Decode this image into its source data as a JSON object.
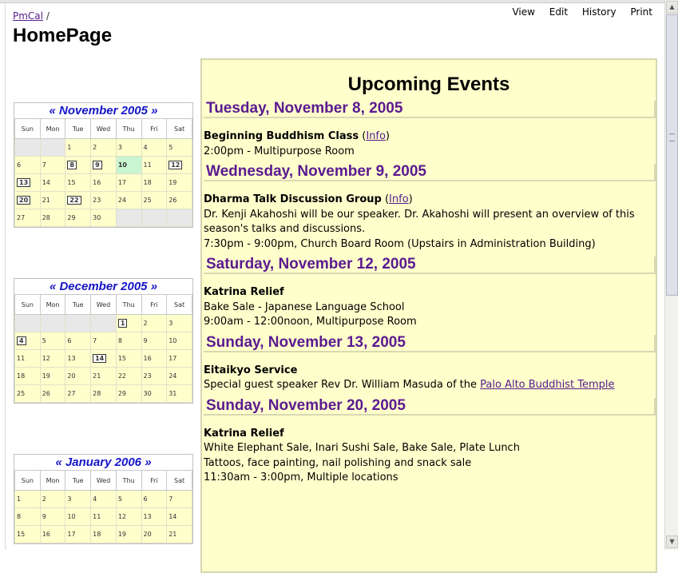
{
  "breadcrumb": {
    "link": "PmCal",
    "sep": "/"
  },
  "page_title": "HomePage",
  "actions": [
    "View",
    "Edit",
    "History",
    "Print"
  ],
  "weekdays": [
    "Sun",
    "Mon",
    "Tue",
    "Wed",
    "Thu",
    "Fri",
    "Sat"
  ],
  "calendars": [
    {
      "prev": "«",
      "month": "November 2005",
      "next": "»",
      "weeks": [
        [
          "",
          "",
          "1",
          "2",
          "3",
          "4",
          "5"
        ],
        [
          "6",
          "7",
          "8",
          "9",
          "10",
          "11",
          "12"
        ],
        [
          "13",
          "14",
          "15",
          "16",
          "17",
          "18",
          "19"
        ],
        [
          "20",
          "21",
          "22",
          "23",
          "24",
          "25",
          "26"
        ],
        [
          "27",
          "28",
          "29",
          "30",
          "",
          "",
          ""
        ]
      ],
      "event_days": [
        "8",
        "9",
        "12",
        "13",
        "20",
        "22"
      ],
      "today": "10"
    },
    {
      "prev": "«",
      "month": "December 2005",
      "next": "»",
      "weeks": [
        [
          "",
          "",
          "",
          "",
          "1",
          "2",
          "3"
        ],
        [
          "4",
          "5",
          "6",
          "7",
          "8",
          "9",
          "10"
        ],
        [
          "11",
          "12",
          "13",
          "14",
          "15",
          "16",
          "17"
        ],
        [
          "18",
          "19",
          "20",
          "21",
          "22",
          "23",
          "24"
        ],
        [
          "25",
          "26",
          "27",
          "28",
          "29",
          "30",
          "31"
        ]
      ],
      "event_days": [
        "1",
        "4",
        "14"
      ],
      "today": ""
    },
    {
      "prev": "«",
      "month": "January 2006",
      "next": "»",
      "weeks": [
        [
          "1",
          "2",
          "3",
          "4",
          "5",
          "6",
          "7"
        ],
        [
          "8",
          "9",
          "10",
          "11",
          "12",
          "13",
          "14"
        ],
        [
          "15",
          "16",
          "17",
          "18",
          "19",
          "20",
          "21"
        ]
      ],
      "event_days": [],
      "today": ""
    }
  ],
  "events": {
    "title": "Upcoming Events",
    "days": [
      {
        "heading": "Tuesday, November 8, 2005",
        "items": [
          {
            "name": "Beginning Buddhism Class",
            "info": "Info",
            "lines": [
              "2:00pm - Multipurpose Room"
            ]
          }
        ]
      },
      {
        "heading": "Wednesday, November 9, 2005",
        "items": [
          {
            "name": "Dharma Talk Discussion Group",
            "info": "Info",
            "lines": [
              "Dr. Kenji Akahoshi will be our speaker. Dr. Akahoshi will present an overview of this season's talks and discussions.",
              "7:30pm - 9:00pm, Church Board Room (Upstairs in Administration Building)"
            ]
          }
        ]
      },
      {
        "heading": "Saturday, November 12, 2005",
        "items": [
          {
            "name": "Katrina Relief",
            "info": "",
            "lines": [
              "Bake Sale - Japanese Language School",
              "9:00am - 12:00noon, Multipurpose Room"
            ]
          }
        ]
      },
      {
        "heading": "Sunday, November 13, 2005",
        "items": [
          {
            "name": "Eitaikyo Service",
            "info": "",
            "lines": [
              "Special guest speaker Rev Dr. William Masuda of the "
            ],
            "link": "Palo Alto Buddhist Temple"
          }
        ]
      },
      {
        "heading": "Sunday, November 20, 2005",
        "items": [
          {
            "name": "Katrina Relief",
            "info": "",
            "lines": [
              "White Elephant Sale, Inari Sushi Sale, Bake Sale, Plate Lunch",
              "Tattoos, face painting, nail polishing and snack sale",
              "11:30am - 3:00pm, Multiple locations"
            ]
          }
        ]
      }
    ]
  },
  "scrollbar": {
    "position": 0
  }
}
